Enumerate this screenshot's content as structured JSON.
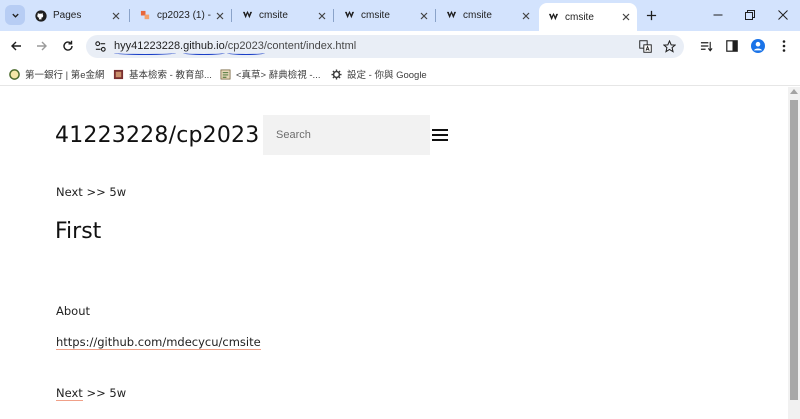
{
  "tabs": [
    {
      "title": "Pages",
      "icon": "github-icon"
    },
    {
      "title": "cp2023 (1) -",
      "icon": "gitlab-like-icon"
    },
    {
      "title": "cmsite",
      "icon": "cmsite-icon"
    },
    {
      "title": "cmsite",
      "icon": "cmsite-icon"
    },
    {
      "title": "cmsite",
      "icon": "cmsite-icon"
    },
    {
      "title": "cmsite",
      "icon": "cmsite-icon",
      "active": true
    }
  ],
  "address_bar": {
    "host": "hyy41223228.github.io",
    "path": "/cp2023/content/index.html"
  },
  "bookmarks": [
    {
      "label": "第一銀行 | 第e金網",
      "icon": "bank-icon"
    },
    {
      "label": "基本檢索 - 教育部...",
      "icon": "book-icon"
    },
    {
      "label": "<真草> 辭典檢視 -...",
      "icon": "dictionary-icon"
    },
    {
      "label": "設定 - 你與 Google",
      "icon": "gear-icon"
    }
  ],
  "page": {
    "site_title": "41223228/cp2023",
    "search_placeholder": "Search",
    "nav_top": {
      "link": "Next",
      "rest": " >> 5w"
    },
    "heading": "First",
    "about": "About",
    "github_link": "https://github.com/mdecycu/cmsite",
    "nav_bottom": {
      "link": "Next",
      "rest": " >> 5w"
    }
  },
  "colors": {
    "tabstrip_bg": "#d3e3fd",
    "omnibox_bg": "#e9eef6",
    "link_underline": "#f0a088",
    "annotation_ink": "#1a3fc7"
  }
}
